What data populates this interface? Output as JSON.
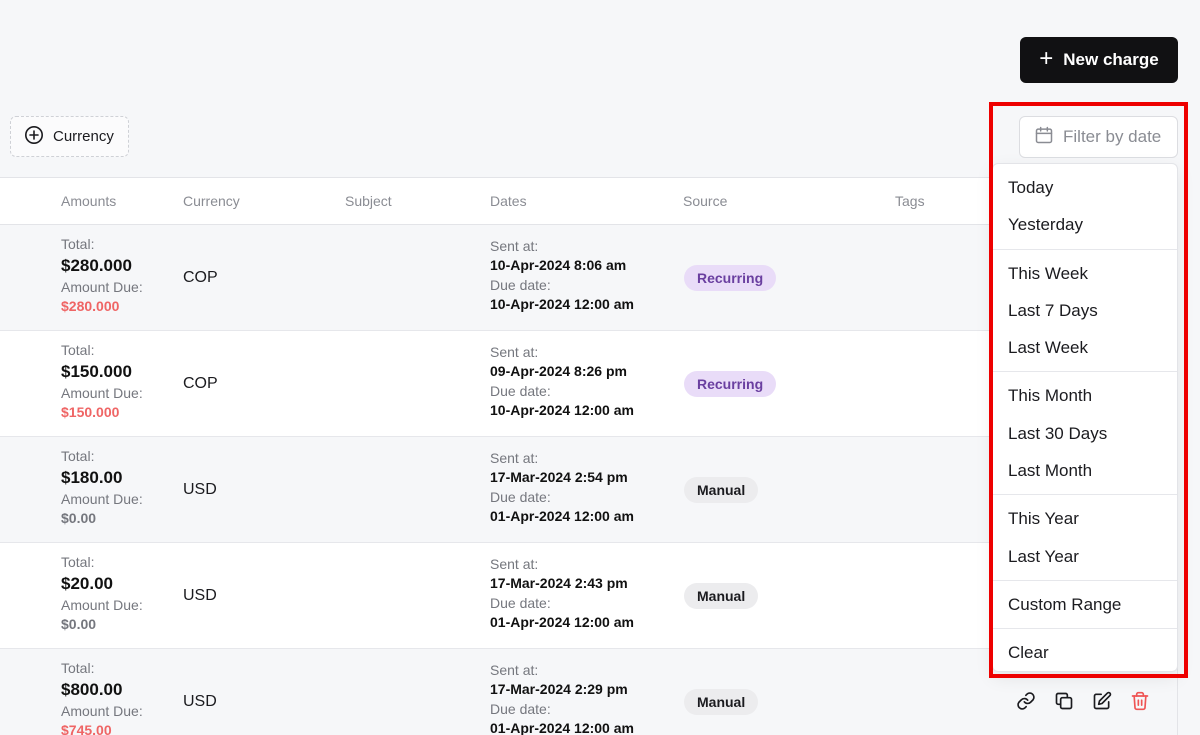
{
  "header": {
    "new_charge_label": "New charge"
  },
  "filters": {
    "currency_label": "Currency",
    "date_placeholder": "Filter by date"
  },
  "table": {
    "columns": [
      "Amounts",
      "Currency",
      "Subject",
      "Dates",
      "Source",
      "Tags"
    ],
    "total_label": "Total:",
    "amount_due_label": "Amount Due:",
    "sent_label": "Sent at:",
    "due_date_label": "Due date:",
    "rows": [
      {
        "total": "$280.000",
        "due": "$280.000",
        "currency": "COP",
        "sent": "10-Apr-2024 8:06 am",
        "due_date": "10-Apr-2024 12:00 am",
        "source": "Recurring"
      },
      {
        "total": "$150.000",
        "due": "$150.000",
        "currency": "COP",
        "sent": "09-Apr-2024 8:26 pm",
        "due_date": "10-Apr-2024 12:00 am",
        "source": "Recurring"
      },
      {
        "total": "$180.00",
        "due": "$0.00",
        "currency": "USD",
        "sent": "17-Mar-2024 2:54 pm",
        "due_date": "01-Apr-2024 12:00 am",
        "source": "Manual"
      },
      {
        "total": "$20.00",
        "due": "$0.00",
        "currency": "USD",
        "sent": "17-Mar-2024 2:43 pm",
        "due_date": "01-Apr-2024 12:00 am",
        "source": "Manual"
      },
      {
        "total": "$800.00",
        "due": "$745.00",
        "currency": "USD",
        "sent": "17-Mar-2024 2:29 pm",
        "due_date": "01-Apr-2024 12:00 am",
        "source": "Manual"
      }
    ]
  },
  "date_menu": {
    "groups": [
      [
        "Today",
        "Yesterday"
      ],
      [
        "This Week",
        "Last 7 Days",
        "Last Week"
      ],
      [
        "This Month",
        "Last 30 Days",
        "Last Month"
      ],
      [
        "This Year",
        "Last Year"
      ],
      [
        "Custom Range"
      ],
      [
        "Clear"
      ]
    ]
  },
  "icons": {
    "new_charge": "plus-icon",
    "currency": "plus-circle-icon",
    "date": "calendar-icon",
    "actions": [
      "link-icon",
      "copy-icon",
      "edit-icon",
      "trash-icon"
    ]
  },
  "colors": {
    "primary_button": "#111113",
    "amount_due_outstanding": "#ef6565",
    "recurring_badge": "#e9dcf8",
    "manual_badge": "#ececee",
    "delete_icon": "#ef5454",
    "highlight": "#ee0000"
  }
}
